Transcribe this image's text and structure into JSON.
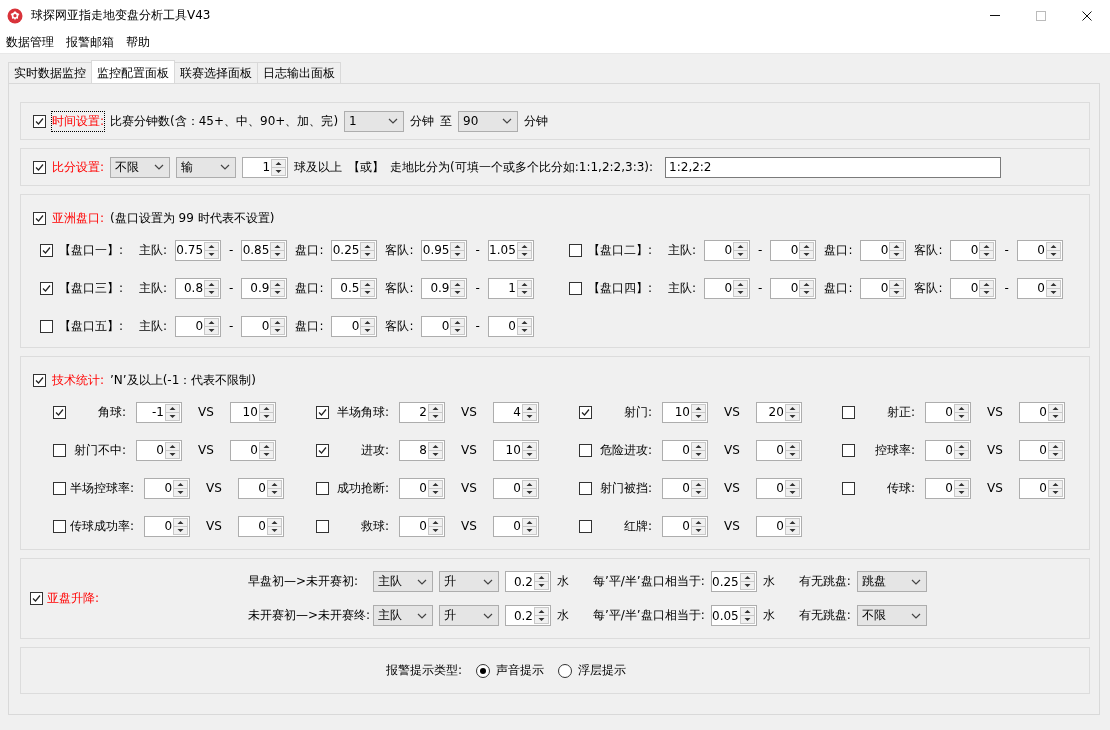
{
  "window": {
    "title": "球探网亚指走地变盘分析工具V43"
  },
  "menu": [
    "数据管理",
    "报警邮箱",
    "帮助"
  ],
  "tabs": [
    {
      "label": "实时数据监控",
      "selected": false
    },
    {
      "label": "监控配置面板",
      "selected": true
    },
    {
      "label": "联赛选择面板",
      "selected": false
    },
    {
      "label": "日志输出面板",
      "selected": false
    }
  ],
  "time_setting": {
    "checked": true,
    "focused": true,
    "label": "时间设置:",
    "parts": [
      {
        "kind": "text",
        "text": "比赛分钟数(含：45+、中、90+、加、完)"
      },
      {
        "kind": "select",
        "value": "1"
      },
      {
        "kind": "text",
        "text": "分钟"
      },
      {
        "kind": "text",
        "text": "至"
      },
      {
        "kind": "select",
        "value": "90"
      },
      {
        "kind": "text",
        "text": "分钟"
      }
    ]
  },
  "score_setting": {
    "checked": true,
    "focused": false,
    "label": "比分设置:",
    "parts": [
      {
        "kind": "select",
        "value": "不限"
      },
      {
        "kind": "select",
        "value": "输"
      },
      {
        "kind": "spin",
        "value": "1"
      },
      {
        "kind": "text",
        "text": "球及以上"
      },
      {
        "kind": "text",
        "text": "【或】"
      },
      {
        "kind": "text",
        "text": "走地比分为(可填一个或多个比分如:1:1,2:2,3:3):"
      },
      {
        "kind": "input",
        "value": "1:2,2:2"
      }
    ]
  },
  "asian_handicap": {
    "checked": true,
    "label": "亚洲盘口:",
    "note": "(盘口设置为 99 时代表不设置)",
    "lines": [
      {
        "checked": true,
        "name": "【盘口一】:",
        "parts": [
          {
            "kind": "text",
            "text": "主队:"
          },
          {
            "kind": "spin",
            "value": "0.75"
          },
          {
            "kind": "text",
            "text": "-"
          },
          {
            "kind": "spin",
            "value": "0.85"
          },
          {
            "kind": "text",
            "text": "盘口:"
          },
          {
            "kind": "spin",
            "value": "0.25"
          },
          {
            "kind": "text",
            "text": "客队:"
          },
          {
            "kind": "spin",
            "value": "0.95"
          },
          {
            "kind": "text",
            "text": "-"
          },
          {
            "kind": "spin",
            "value": "1.05"
          }
        ]
      },
      {
        "checked": false,
        "name": "【盘口二】:",
        "parts": [
          {
            "kind": "text",
            "text": "主队:"
          },
          {
            "kind": "spin",
            "value": "0"
          },
          {
            "kind": "text",
            "text": "-"
          },
          {
            "kind": "spin",
            "value": "0"
          },
          {
            "kind": "text",
            "text": "盘口:"
          },
          {
            "kind": "spin",
            "value": "0"
          },
          {
            "kind": "text",
            "text": "客队:"
          },
          {
            "kind": "spin",
            "value": "0"
          },
          {
            "kind": "text",
            "text": "-"
          },
          {
            "kind": "spin",
            "value": "0"
          }
        ]
      },
      {
        "checked": true,
        "name": "【盘口三】:",
        "parts": [
          {
            "kind": "text",
            "text": "主队:"
          },
          {
            "kind": "spin",
            "value": "0.8"
          },
          {
            "kind": "text",
            "text": "-"
          },
          {
            "kind": "spin",
            "value": "0.9"
          },
          {
            "kind": "text",
            "text": "盘口:"
          },
          {
            "kind": "spin",
            "value": "0.5"
          },
          {
            "kind": "text",
            "text": "客队:"
          },
          {
            "kind": "spin",
            "value": "0.9"
          },
          {
            "kind": "text",
            "text": "-"
          },
          {
            "kind": "spin",
            "value": "1"
          }
        ]
      },
      {
        "checked": false,
        "name": "【盘口四】:",
        "parts": [
          {
            "kind": "text",
            "text": "主队:"
          },
          {
            "kind": "spin",
            "value": "0"
          },
          {
            "kind": "text",
            "text": "-"
          },
          {
            "kind": "spin",
            "value": "0"
          },
          {
            "kind": "text",
            "text": "盘口:"
          },
          {
            "kind": "spin",
            "value": "0"
          },
          {
            "kind": "text",
            "text": "客队:"
          },
          {
            "kind": "spin",
            "value": "0"
          },
          {
            "kind": "text",
            "text": "-"
          },
          {
            "kind": "spin",
            "value": "0"
          }
        ]
      },
      {
        "checked": false,
        "name": "【盘口五】:",
        "parts": [
          {
            "kind": "text",
            "text": "主队:"
          },
          {
            "kind": "spin",
            "value": "0"
          },
          {
            "kind": "text",
            "text": "-"
          },
          {
            "kind": "spin",
            "value": "0"
          },
          {
            "kind": "text",
            "text": "盘口:"
          },
          {
            "kind": "spin",
            "value": "0"
          },
          {
            "kind": "text",
            "text": "客队:"
          },
          {
            "kind": "spin",
            "value": "0"
          },
          {
            "kind": "text",
            "text": "-"
          },
          {
            "kind": "spin",
            "value": "0"
          }
        ]
      }
    ]
  },
  "tech_stats": {
    "checked": true,
    "label": "技术统计:",
    "note": "’N’及以上(-1：代表不限制)",
    "items": [
      {
        "checked": true,
        "label": "角球:",
        "min": "-1",
        "vs": "VS",
        "max": "10"
      },
      {
        "checked": true,
        "label": "半场角球:",
        "min": "2",
        "vs": "VS",
        "max": "4"
      },
      {
        "checked": true,
        "label": "射门:",
        "min": "10",
        "vs": "VS",
        "max": "20"
      },
      {
        "checked": false,
        "label": "射正:",
        "min": "0",
        "vs": "VS",
        "max": "0"
      },
      {
        "checked": false,
        "label": "射门不中:",
        "min": "0",
        "vs": "VS",
        "max": "0"
      },
      {
        "checked": true,
        "label": "进攻:",
        "min": "8",
        "vs": "VS",
        "max": "10"
      },
      {
        "checked": false,
        "label": "危险进攻:",
        "min": "0",
        "vs": "VS",
        "max": "0"
      },
      {
        "checked": false,
        "label": "控球率:",
        "min": "0",
        "vs": "VS",
        "max": "0"
      },
      {
        "checked": false,
        "label": "半场控球率:",
        "min": "0",
        "vs": "VS",
        "max": "0"
      },
      {
        "checked": false,
        "label": "成功抢断:",
        "min": "0",
        "vs": "VS",
        "max": "0"
      },
      {
        "checked": false,
        "label": "射门被挡:",
        "min": "0",
        "vs": "VS",
        "max": "0"
      },
      {
        "checked": false,
        "label": "传球:",
        "min": "0",
        "vs": "VS",
        "max": "0"
      },
      {
        "checked": false,
        "label": "传球成功率:",
        "min": "0",
        "vs": "VS",
        "max": "0"
      },
      {
        "checked": false,
        "label": "救球:",
        "min": "0",
        "vs": "VS",
        "max": "0"
      },
      {
        "checked": false,
        "label": "红牌:",
        "min": "0",
        "vs": "VS",
        "max": "0"
      }
    ]
  },
  "handicap_change": {
    "checked": true,
    "label": "亚盘升降:",
    "rows": [
      {
        "parts": [
          {
            "kind": "text",
            "text": "早盘初—>未开赛初:"
          },
          {
            "kind": "select",
            "value": "主队"
          },
          {
            "kind": "select",
            "value": "升"
          },
          {
            "kind": "spin",
            "value": "0.2"
          },
          {
            "kind": "text",
            "text": "水"
          },
          {
            "kind": "label",
            "text": "每’平/半’盘口相当于:"
          },
          {
            "kind": "spin",
            "value": "0.25"
          },
          {
            "kind": "text",
            "text": "水"
          },
          {
            "kind": "label",
            "text": "有无跳盘:"
          },
          {
            "kind": "select",
            "value": "跳盘"
          }
        ]
      },
      {
        "parts": [
          {
            "kind": "text",
            "text": "未开赛初—>未开赛终:"
          },
          {
            "kind": "select",
            "value": "主队"
          },
          {
            "kind": "select",
            "value": "升"
          },
          {
            "kind": "spin",
            "value": "0.2"
          },
          {
            "kind": "text",
            "text": "水"
          },
          {
            "kind": "label",
            "text": "每’平/半’盘口相当于:"
          },
          {
            "kind": "spin",
            "value": "0.05"
          },
          {
            "kind": "text",
            "text": "水"
          },
          {
            "kind": "label",
            "text": "有无跳盘:"
          },
          {
            "kind": "select",
            "value": "不限"
          }
        ]
      }
    ]
  },
  "alert": {
    "label": "报警提示类型:",
    "options": [
      {
        "label": "声音提示",
        "selected": true
      },
      {
        "label": "浮层提示",
        "selected": false
      }
    ]
  }
}
